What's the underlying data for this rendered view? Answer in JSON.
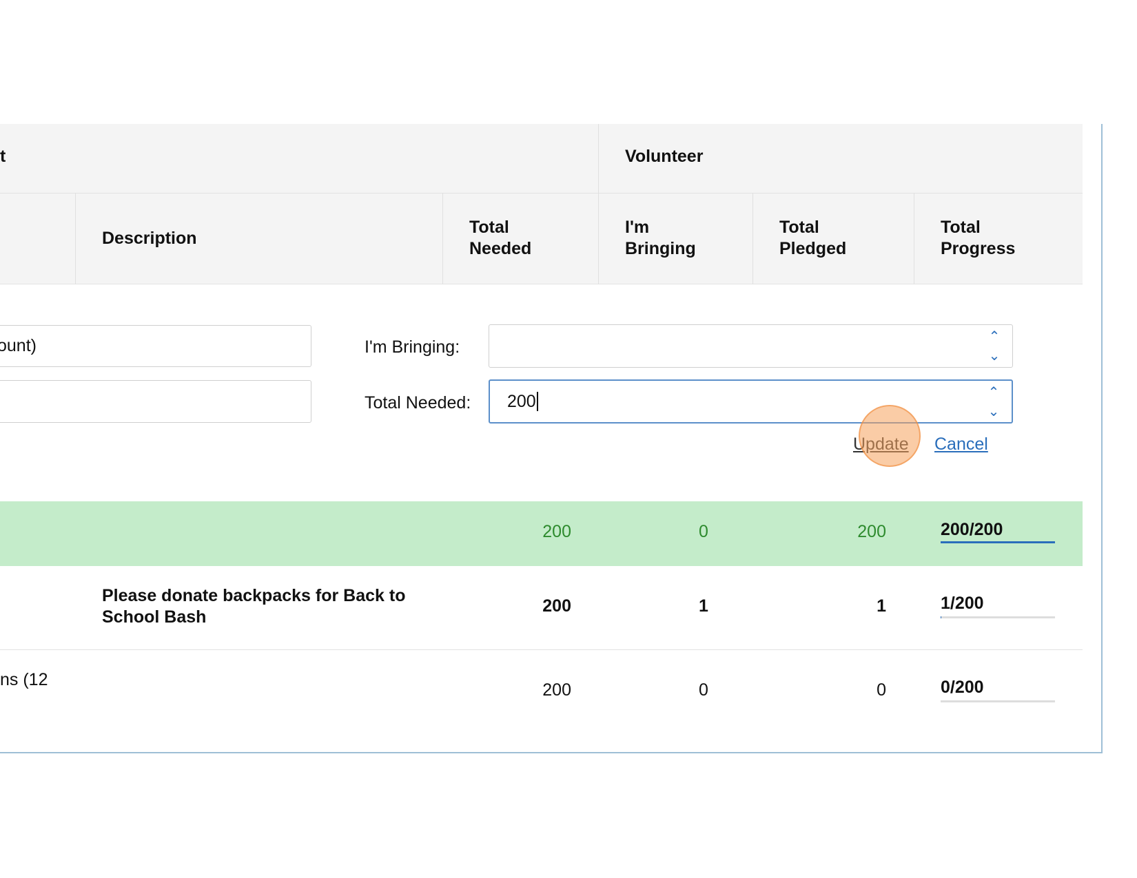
{
  "header": {
    "group_left": "t",
    "group_volunteer": "Volunteer",
    "columns": {
      "description": "Description",
      "total_needed": "Total Needed",
      "im_bringing": "I'm Bringing",
      "total_pledged": "Total Pledged",
      "total_progress": "Total Progress"
    }
  },
  "form": {
    "left_field_1_value": "ount)",
    "left_field_2_value": "",
    "im_bringing_label": "I'm Bringing:",
    "im_bringing_value": "",
    "total_needed_label": "Total Needed:",
    "total_needed_value": "200",
    "update_label": "Update",
    "cancel_label": "Cancel"
  },
  "rows": [
    {
      "description": "",
      "total_needed": "200",
      "im_bringing": "0",
      "total_pledged": "200",
      "progress": "200/200",
      "progress_fraction": 1.0,
      "color": "#2e8b2e",
      "bg": "#c4ecca"
    },
    {
      "description": "Please donate backpacks for Back to School Bash",
      "total_needed": "200",
      "im_bringing": "1",
      "total_pledged": "1",
      "progress": "1/200",
      "progress_fraction": 0.005
    },
    {
      "description": "ns (12",
      "total_needed": "200",
      "im_bringing": "0",
      "total_pledged": "0",
      "progress": "0/200",
      "progress_fraction": 0
    }
  ],
  "colors": {
    "accent": "#2a6ebb",
    "highlight_row": "#c4ecca",
    "click_marker": "#f5a25d"
  }
}
